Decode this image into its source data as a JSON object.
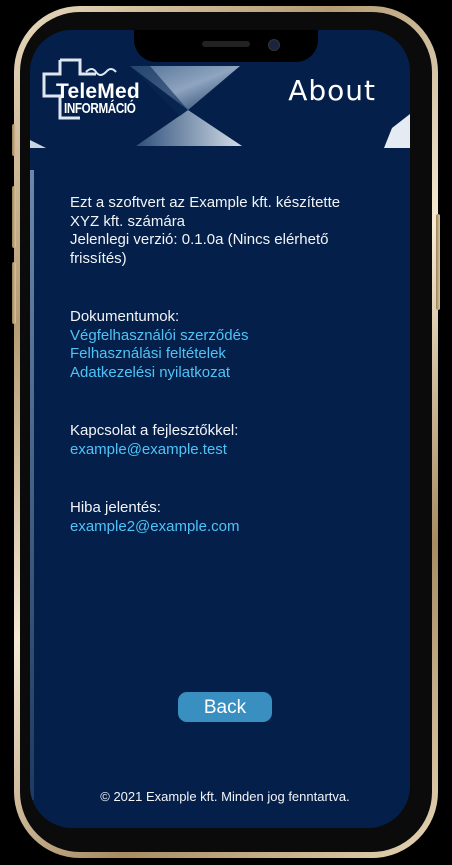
{
  "logo": {
    "name": "TeleMed",
    "subtitle": "INFORMÁCIÓ"
  },
  "header": {
    "title": "About"
  },
  "intro": {
    "line1": "Ezt a szoftvert az Example kft. készítette",
    "line2": "XYZ kft. számára",
    "line3": "Jelenlegi verzió: 0.1.0a (Nincs elérhető",
    "line4": "frissítés)"
  },
  "documents": {
    "heading": "Dokumentumok:",
    "links": [
      "Végfelhasználói szerződés",
      "Felhasználási feltételek",
      "Adatkezelési nyilatkozat"
    ]
  },
  "contact": {
    "heading": "Kapcsolat a fejlesztőkkel:",
    "email": "example@example.test"
  },
  "bug_report": {
    "heading": "Hiba jelentés:",
    "email": "example2@example.com"
  },
  "back_button": "Back",
  "footer": "© 2021 Example kft. Minden jog fenntartva.",
  "colors": {
    "background": "#04204a",
    "link": "#4fc3f7",
    "button": "#3a8fc1",
    "frame": "#c8b088"
  }
}
